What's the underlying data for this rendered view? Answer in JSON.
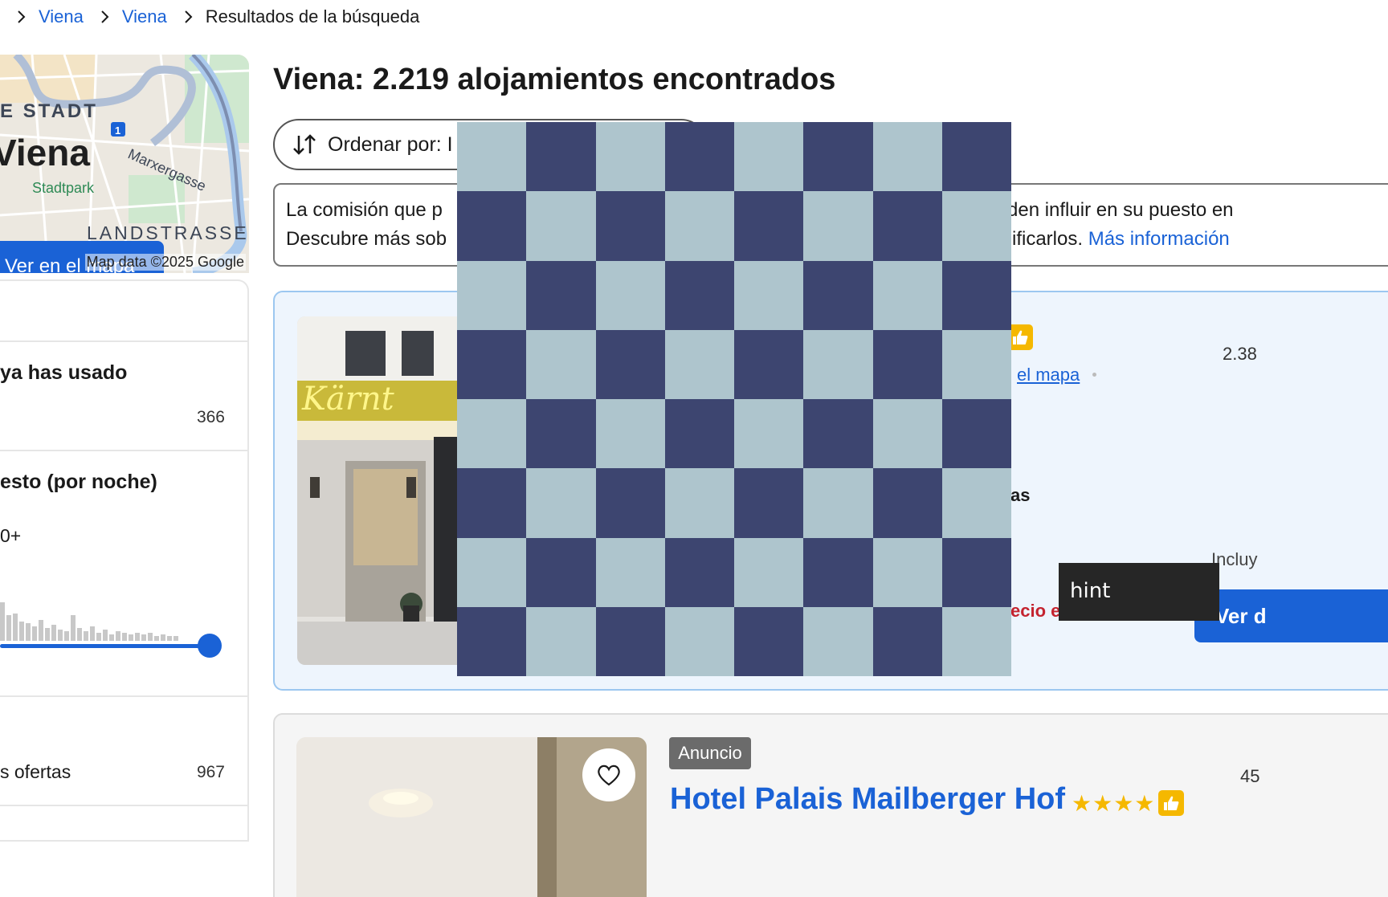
{
  "breadcrumb": {
    "items": [
      "Viena",
      "Viena"
    ],
    "current": "Resultados de la búsqueda"
  },
  "map": {
    "district": "E STADT",
    "city": "Viena",
    "street": "Marxergasse",
    "district2": "LANDSTRASSE",
    "partial_label": "Stadtpark",
    "pin_number": "1",
    "button_label": "Ver en el mapa",
    "credit": "Map data ©2025 Google"
  },
  "filters": {
    "used_title": "ya has usado",
    "used_count": "366",
    "budget_title": "esto (por noche)",
    "budget_value": "0+",
    "offers_label": "s ofertas",
    "offers_count": "967"
  },
  "main": {
    "title": "Viena: 2.219 alojamientos encontrados",
    "sort_label": "Ordenar por: I"
  },
  "notice": {
    "left_line1": "La comisión que p",
    "left_line2": "Descubre más sob",
    "right_line1": "den influir en su puesto en",
    "right_line2": "ificarlos.",
    "link": "Más información"
  },
  "card1": {
    "sign_text": "Kärnt",
    "map_link": "el mapa",
    "distance": "2.38",
    "partial_text": "as",
    "included": "Incluy",
    "price_partial": "ecio e",
    "button": "Ver d"
  },
  "hint": {
    "text": "hint"
  },
  "card2": {
    "ad_badge": "Anuncio",
    "hotel_name": "Hotel Palais Mailberger Hof",
    "stars": "★★★★",
    "distance": "45"
  },
  "colors": {
    "accent": "#1a62d6",
    "star": "#f5b800",
    "price_red": "#c4232f",
    "overlay_light": "#aec5cd",
    "overlay_dark": "#3d4570"
  }
}
